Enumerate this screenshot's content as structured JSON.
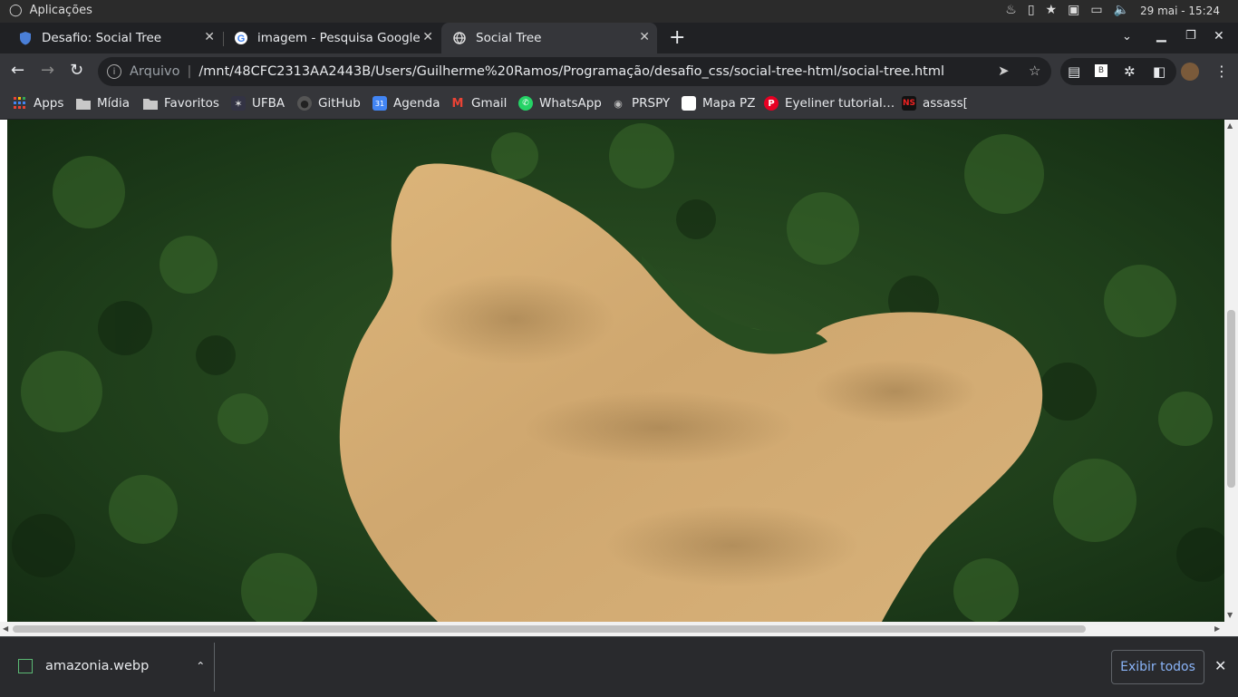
{
  "os": {
    "app_name": "Aplicações",
    "clock": "29 mai - 15:24"
  },
  "tabs": [
    {
      "title": "Desafio: Social Tree",
      "active": false
    },
    {
      "title": "imagem - Pesquisa Google",
      "active": false
    },
    {
      "title": "Social Tree",
      "active": true
    }
  ],
  "toolbar": {
    "info_label": "Arquivo",
    "url": "/mnt/48CFC2313AA2443B/Users/Guilherme%20Ramos/Programação/desafio_css/social-tree-html/social-tree.html"
  },
  "bookmarks": [
    {
      "label": "Apps",
      "icon": "apps-grid-icon"
    },
    {
      "label": "Mídia",
      "icon": "folder-icon"
    },
    {
      "label": "Favoritos",
      "icon": "folder-icon"
    },
    {
      "label": "UFBA",
      "icon": "ufba-icon"
    },
    {
      "label": "GitHub",
      "icon": "github-icon"
    },
    {
      "label": "Agenda",
      "icon": "calendar-icon"
    },
    {
      "label": "Gmail",
      "icon": "gmail-icon"
    },
    {
      "label": "WhatsApp",
      "icon": "whatsapp-icon"
    },
    {
      "label": "PRSPY",
      "icon": "prspy-icon"
    },
    {
      "label": "Mapa PZ",
      "icon": "page-icon"
    },
    {
      "label": "Eyeliner tutorial…",
      "icon": "pinterest-icon"
    },
    {
      "label": "assass[",
      "icon": "ns-icon"
    }
  ],
  "download": {
    "filename": "amazonia.webp",
    "show_all": "Exibir todos"
  },
  "colors": {
    "forest": "#1e3a1a",
    "lake": "#d2ad74",
    "link": "#8ab4f8"
  }
}
